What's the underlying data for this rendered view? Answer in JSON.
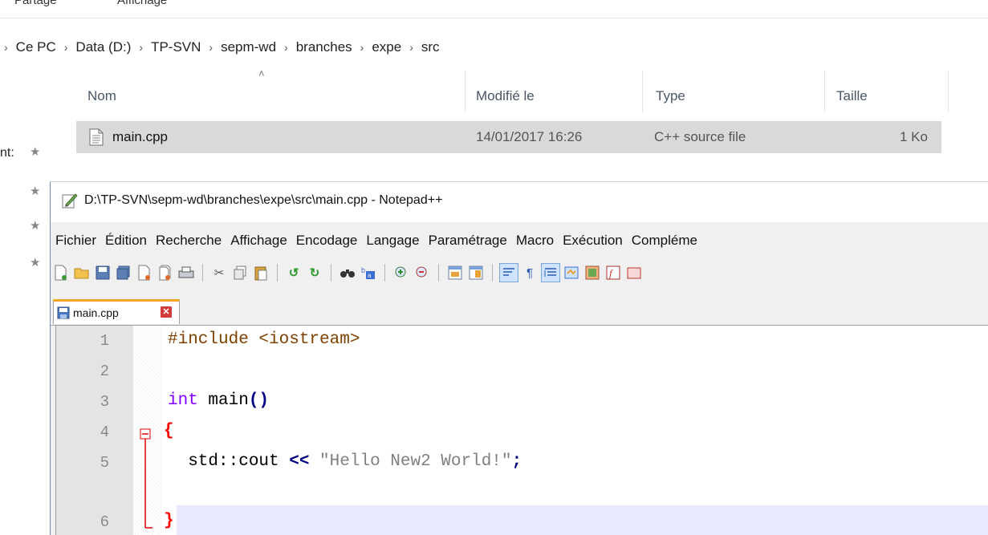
{
  "explorer": {
    "ribbon_tabs": [
      "Partage",
      "Affichage"
    ],
    "breadcrumb": [
      "Ce PC",
      "Data (D:)",
      "TP-SVN",
      "sepm-wd",
      "branches",
      "expe",
      "src"
    ],
    "columns": {
      "name": "Nom",
      "modified": "Modifié le",
      "type": "Type",
      "size": "Taille"
    },
    "files": [
      {
        "name": "main.cpp",
        "modified": "14/01/2017 16:26",
        "type": "C++ source file",
        "size": "1 Ko"
      }
    ],
    "left_nav_partial_label": "nt:"
  },
  "notepad": {
    "title": "D:\\TP-SVN\\sepm-wd\\branches\\expe\\src\\main.cpp - Notepad++",
    "menu": [
      "Fichier",
      "Édition",
      "Recherche",
      "Affichage",
      "Encodage",
      "Langage",
      "Paramétrage",
      "Macro",
      "Exécution",
      "Compléme"
    ],
    "tab_label": "main.cpp",
    "line_numbers": [
      "1",
      "2",
      "3",
      "4",
      "5",
      "6"
    ],
    "code": {
      "l1": "#include <iostream>",
      "l3_kw": "int",
      "l3_rest": " main",
      "l3_parens": "()",
      "l4": "{",
      "l5_pre": "  std::cout ",
      "l5_op": "<<",
      "l5_str": " \"Hello New2 World!\"",
      "l5_end": ";",
      "l6": "}"
    },
    "colors": {
      "keyword": "#8000ff",
      "brace": "#ff0000",
      "op": "#000080",
      "string": "#808080",
      "tab_accent": "#f5a623"
    }
  }
}
